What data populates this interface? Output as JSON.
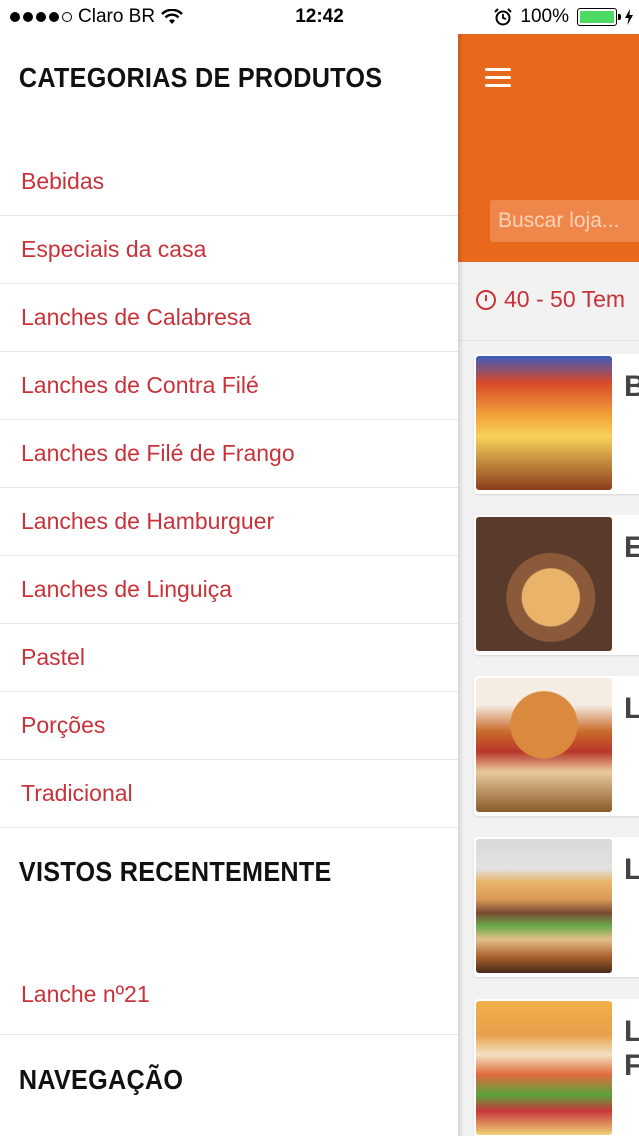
{
  "status_bar": {
    "carrier": "Claro BR",
    "time": "12:42",
    "battery_percent": "100%",
    "signal_bars": 4,
    "icons": [
      "wifi-icon",
      "alarm-icon",
      "battery-icon",
      "charging-icon"
    ]
  },
  "drawer": {
    "categories_title": "CATEGORIAS DE PRODUTOS",
    "categories": [
      {
        "label": "Bebidas"
      },
      {
        "label": "Especiais da casa"
      },
      {
        "label": "Lanches de Calabresa"
      },
      {
        "label": "Lanches de Contra Filé"
      },
      {
        "label": "Lanches de Filé de Frango"
      },
      {
        "label": "Lanches de Hamburguer"
      },
      {
        "label": "Lanches de Linguiça"
      },
      {
        "label": "Pastel"
      },
      {
        "label": "Porções"
      },
      {
        "label": "Tradicional"
      }
    ],
    "recent_title": "VISTOS RECENTEMENTE",
    "recent": [
      {
        "label": "Lanche nº21"
      }
    ],
    "navigation_title": "NAVEGAÇÃO"
  },
  "main": {
    "search_placeholder": "Buscar loja...",
    "delivery_time": "40 - 50 Tem",
    "cards": [
      {
        "letter": "B"
      },
      {
        "letter": "E"
      },
      {
        "letter": "L"
      },
      {
        "letter": "L"
      },
      {
        "letter": "L\nF"
      }
    ]
  },
  "colors": {
    "accent": "#e8691c",
    "link_red": "#c8323a"
  }
}
